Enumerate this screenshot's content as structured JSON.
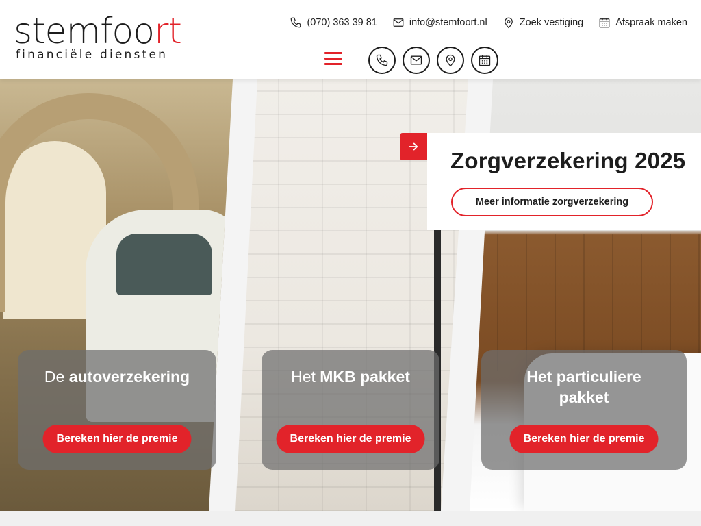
{
  "logo": {
    "main_prefix": "stemfoo",
    "main_accent": "rt",
    "tagline": "financiële diensten"
  },
  "contact": {
    "phone": "(070) 363 39 81",
    "email": "info@stemfoort.nl",
    "location": "Zoek vestiging",
    "appointment": "Afspraak maken"
  },
  "feature": {
    "title": "Zorgverzekering 2025",
    "button": "Meer informatie zorgverzekering"
  },
  "cards": [
    {
      "title_prefix": "De ",
      "title_bold": "autoverzekering",
      "button": "Bereken hier de premie"
    },
    {
      "title_prefix": "Het ",
      "title_bold": "MKB pakket",
      "button": "Bereken hier de premie"
    },
    {
      "title_prefix": "",
      "title_bold": "Het particuliere pakket",
      "button": "Bereken hier de premie"
    }
  ],
  "colors": {
    "accent": "#e2232a",
    "text": "#1d1d1d"
  },
  "icons": [
    "phone-icon",
    "mail-icon",
    "location-pin-icon",
    "calendar-icon",
    "menu-icon",
    "arrow-right-icon"
  ]
}
